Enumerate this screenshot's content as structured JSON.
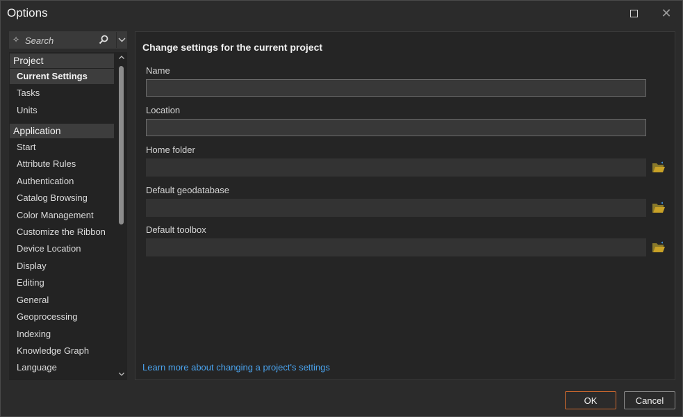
{
  "window": {
    "title": "Options",
    "maximize_icon": "maximize-icon",
    "close_label": "✕"
  },
  "search": {
    "placeholder": "Search",
    "icon": "search-icon",
    "assist_icon": "sparkle-icon",
    "dropdown_icon": "chevron-down-icon"
  },
  "nav": {
    "groups": [
      {
        "label": "Project",
        "items": [
          {
            "label": "Current Settings",
            "selected": true
          },
          {
            "label": "Tasks"
          },
          {
            "label": "Units"
          }
        ]
      },
      {
        "label": "Application",
        "items": [
          {
            "label": "Start"
          },
          {
            "label": "Attribute Rules"
          },
          {
            "label": "Authentication"
          },
          {
            "label": "Catalog Browsing"
          },
          {
            "label": "Color Management"
          },
          {
            "label": "Customize the Ribbon"
          },
          {
            "label": "Device Location"
          },
          {
            "label": "Display"
          },
          {
            "label": "Editing"
          },
          {
            "label": "General"
          },
          {
            "label": "Geoprocessing"
          },
          {
            "label": "Indexing"
          },
          {
            "label": "Knowledge Graph"
          },
          {
            "label": "Language"
          }
        ]
      }
    ]
  },
  "panel": {
    "title": "Change settings for the current project",
    "fields": {
      "name": {
        "label": "Name",
        "value": ""
      },
      "location": {
        "label": "Location",
        "value": ""
      },
      "home_folder": {
        "label": "Home folder",
        "value": ""
      },
      "default_geodatabase": {
        "label": "Default geodatabase",
        "value": ""
      },
      "default_toolbox": {
        "label": "Default toolbox",
        "value": ""
      }
    },
    "browse_icon": "folder-open-icon",
    "learn_more": "Learn more about changing a project's settings"
  },
  "buttons": {
    "ok": "OK",
    "cancel": "Cancel"
  },
  "colors": {
    "accent_ok_border": "#d26a2e",
    "link": "#4aa3ee",
    "folder_icon": "#c9a227"
  }
}
